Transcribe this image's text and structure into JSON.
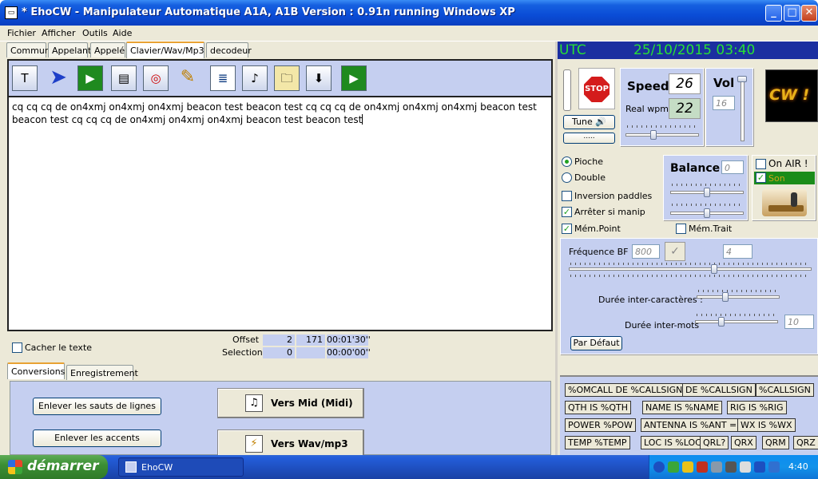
{
  "window": {
    "app_icon": "app-icon",
    "title": "* EhoCW - Manipulateur Automatique  A1A, A1B Version : 0.91n  running Windows XP",
    "buttons": {
      "minimize": "_",
      "maximize": "□",
      "close": "✕"
    }
  },
  "menu": [
    "Fichier",
    "Afficher",
    "Outils",
    "Aide"
  ],
  "tabs": [
    "Commun",
    "Appelant",
    "Appelé",
    "Clavier/Wav/Mp3",
    "decodeur"
  ],
  "active_tab": "Clavier/Wav/Mp3",
  "toolbar_icons": [
    "text-icon",
    "cursor-arrow-icon",
    "play-icon",
    "open-file-icon",
    "cd-file-icon",
    "pencil-icon",
    "document-icon",
    "audio-file-icon",
    "folder-icon",
    "save-icon",
    "play-audio-icon"
  ],
  "editor": {
    "text": "cq cq cq de on4xmj on4xmj on4xmj beacon test beacon test cq cq cq de on4xmj on4xmj on4xmj beacon test beacon test cq cq cq de on4xmj on4xmj on4xmj beacon test beacon test"
  },
  "info": {
    "hide_text_label": "Cacher le texte",
    "offset_label": "Offset",
    "offset_value": "2",
    "offset_count": "171",
    "offset_time": "00:01'30''",
    "selection_label": "Selection",
    "selection_value": "0",
    "selection_time": "00:00'00''"
  },
  "subtabs": [
    "Conversions",
    "Enregistrement"
  ],
  "conversions": {
    "remove_line_breaks": "Enlever les sauts de lignes",
    "remove_accents": "Enlever les accents",
    "to_midi": "Vers Mid (Midi)",
    "to_wav": "Vers Wav/mp3"
  },
  "right": {
    "utc_label": "UTC",
    "datetime": "25/10/2015 03:40",
    "stop": "STOP",
    "tune": "Tune",
    "tune_sub": ".....",
    "speed_label": "Speed",
    "speed_value": "26",
    "real_wpm_label": "Real wpm:",
    "real_wpm_value": "22",
    "vol_label": "Vol",
    "vol_value": "16",
    "cw_logo": "CW !",
    "pioche": "Pioche",
    "double": "Double",
    "inversion": "Inversion paddles",
    "arreter": "Arrêter si manip",
    "mem_point": "Mém.Point",
    "mem_trait": "Mém.Trait",
    "balance_label": "Balance",
    "balance_value": "0",
    "on_air": "On AIR !",
    "son": "Son",
    "freq_label": "Fréquence BF :",
    "freq_value": "800",
    "freq_step": "4",
    "inter_char": "Durée inter-caractères :",
    "inter_word": "Durée inter-mots",
    "inter_word_value": "10",
    "default_btn": "Par Défaut"
  },
  "macros": [
    "%OMCALL DE %CALLSIGN",
    "DE %CALLSIGN",
    "%CALLSIGN",
    "QTH IS %QTH",
    "NAME IS %NAME",
    "RIG IS %RIG",
    "POWER %POW",
    "ANTENNA IS %ANT =",
    "WX IS %WX",
    "TEMP %TEMP",
    "LOC IS %LOC",
    "QRL?",
    "QRX",
    "QRM",
    "QRZ"
  ],
  "taskbar": {
    "start": "démarrer",
    "task": "EhoCW",
    "clock": "4:40"
  },
  "colors": {
    "accent_panel": "#c5cff0",
    "utc_bg": "#1b2fa0",
    "utc_text": "#27e035",
    "son_bg": "#1a8c1a"
  }
}
